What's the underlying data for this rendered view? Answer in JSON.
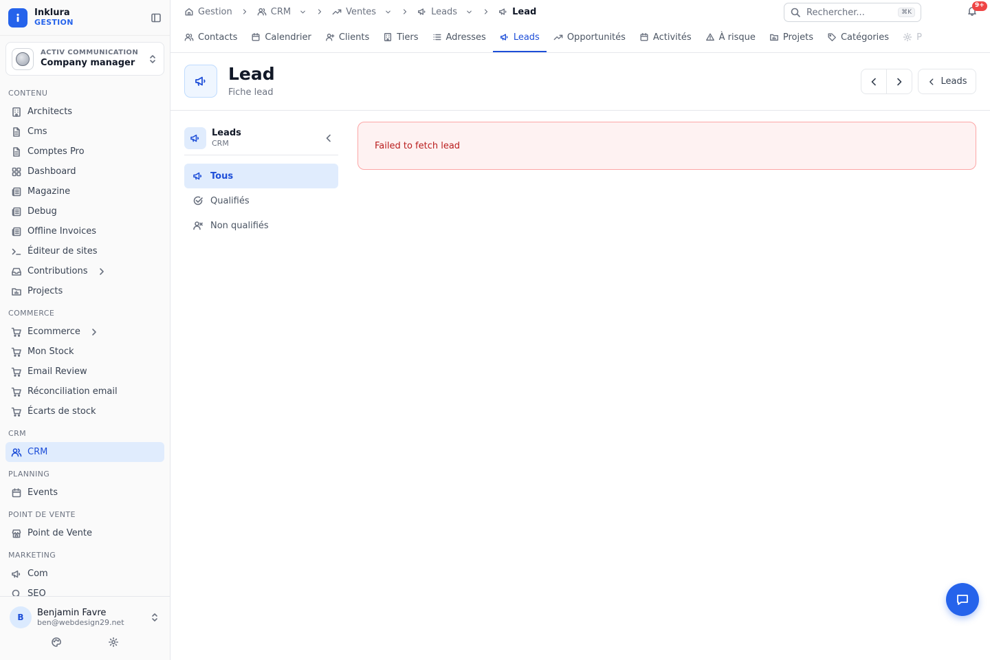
{
  "brand": {
    "name": "Inklura",
    "sub": "GESTION",
    "color": "#2563eb"
  },
  "company": {
    "kicker": "ACTIV COMMUNICATION",
    "name": "Company manager"
  },
  "sidebar": {
    "sections": [
      {
        "title": "CONTENU",
        "items": [
          {
            "label": "Architects",
            "icon": "building-icon"
          },
          {
            "label": "Cms",
            "icon": "file-icon"
          },
          {
            "label": "Comptes Pro",
            "icon": "file-icon"
          },
          {
            "label": "Dashboard",
            "icon": "grid-icon"
          },
          {
            "label": "Magazine",
            "icon": "newspaper-icon"
          },
          {
            "label": "Debug",
            "icon": "newspaper-icon"
          },
          {
            "label": "Offline Invoices",
            "icon": "newspaper-icon"
          },
          {
            "label": "Éditeur de sites",
            "icon": "terminal-icon"
          },
          {
            "label": "Contributions",
            "icon": "inbox-icon",
            "chevron": true
          },
          {
            "label": "Projects",
            "icon": "folder-icon"
          }
        ]
      },
      {
        "title": "COMMERCE",
        "items": [
          {
            "label": "Ecommerce",
            "icon": "cart-icon",
            "chevron": true
          },
          {
            "label": "Mon Stock",
            "icon": "cart-icon"
          },
          {
            "label": "Email Review",
            "icon": "cart-icon"
          },
          {
            "label": "Réconciliation email",
            "icon": "cart-icon"
          },
          {
            "label": "Écarts de stock",
            "icon": "cart-icon"
          }
        ]
      },
      {
        "title": "CRM",
        "items": [
          {
            "label": "CRM",
            "icon": "users-icon",
            "active": true
          }
        ]
      },
      {
        "title": "PLANNING",
        "items": [
          {
            "label": "Events",
            "icon": "calendar-icon"
          }
        ]
      },
      {
        "title": "POINT DE VENTE",
        "items": [
          {
            "label": "Point de Vente",
            "icon": "store-icon"
          }
        ]
      },
      {
        "title": "MARKETING",
        "items": [
          {
            "label": "Com",
            "icon": "megaphone-icon"
          },
          {
            "label": "SEO",
            "icon": "search-icon"
          }
        ]
      }
    ]
  },
  "user": {
    "initial": "B",
    "name": "Benjamin Favre",
    "email": "ben@webdesign29.net"
  },
  "breadcrumb": [
    {
      "label": "Gestion",
      "icon": "home-icon"
    },
    {
      "label": "CRM",
      "icon": "users-icon",
      "dropdown": true
    },
    {
      "label": "Ventes",
      "icon": "trending-icon",
      "dropdown": true
    },
    {
      "label": "Leads",
      "icon": "megaphone-icon",
      "dropdown": true
    },
    {
      "label": "Lead",
      "icon": "megaphone-icon",
      "current": true
    }
  ],
  "search": {
    "placeholder": "Rechercher...",
    "shortcut": "⌘K"
  },
  "notifications": {
    "badge": "9+"
  },
  "tabs": [
    {
      "label": "Contacts",
      "icon": "users-icon"
    },
    {
      "label": "Calendrier",
      "icon": "calendar-icon"
    },
    {
      "label": "Clients",
      "icon": "user-plus-icon"
    },
    {
      "label": "Tiers",
      "icon": "building-icon"
    },
    {
      "label": "Adresses",
      "icon": "list-icon"
    },
    {
      "label": "Leads",
      "icon": "megaphone-icon",
      "active": true
    },
    {
      "label": "Opportunités",
      "icon": "trending-icon"
    },
    {
      "label": "Activités",
      "icon": "calendar-icon"
    },
    {
      "label": "À risque",
      "icon": "alert-icon"
    },
    {
      "label": "Projets",
      "icon": "folder-icon"
    },
    {
      "label": "Catégories",
      "icon": "tag-icon"
    },
    {
      "label": "P",
      "icon": "gear-icon",
      "faded": true
    }
  ],
  "header": {
    "title": "Lead",
    "subtitle": "Fiche lead",
    "back_label": "Leads"
  },
  "subnav": {
    "title": "Leads",
    "subtitle": "CRM",
    "items": [
      {
        "label": "Tous",
        "icon": "megaphone-icon",
        "active": true
      },
      {
        "label": "Qualifiés",
        "icon": "check-circle-icon"
      },
      {
        "label": "Non qualifiés",
        "icon": "user-x-icon"
      }
    ]
  },
  "error": {
    "message": "Failed to fetch lead"
  }
}
